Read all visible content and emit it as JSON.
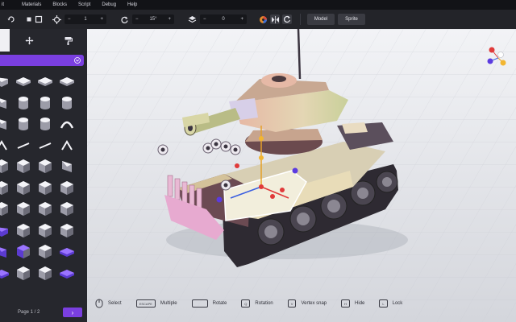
{
  "menu": [
    "it",
    "Materials",
    "Blocks",
    "Script",
    "Debug",
    "Help"
  ],
  "toolbar": {
    "position_value": "1",
    "rotation_value": "15°",
    "scale_value": "0",
    "mode_model": "Model",
    "mode_sprite": "Sprite"
  },
  "panel": {
    "tabs": [
      "select-tab",
      "move-tab",
      "paint-tab"
    ],
    "page_label": "Page 1 / 2",
    "next_glyph": "›"
  },
  "hints": [
    {
      "key": "",
      "label": "Select"
    },
    {
      "key": "ESCAPE",
      "label": "Multiple"
    },
    {
      "key": "",
      "label": "Rotate"
    },
    {
      "key": "Q",
      "label": "Rotation"
    },
    {
      "key": "V",
      "label": "Vertex snap"
    },
    {
      "key": "H",
      "label": "Hide"
    },
    {
      "key": "L",
      "label": "Lock"
    }
  ],
  "colors": {
    "accent": "#7a3fe0",
    "panel": "#26272d",
    "toolbar": "#232429",
    "viewport": "#dfe1e6"
  }
}
